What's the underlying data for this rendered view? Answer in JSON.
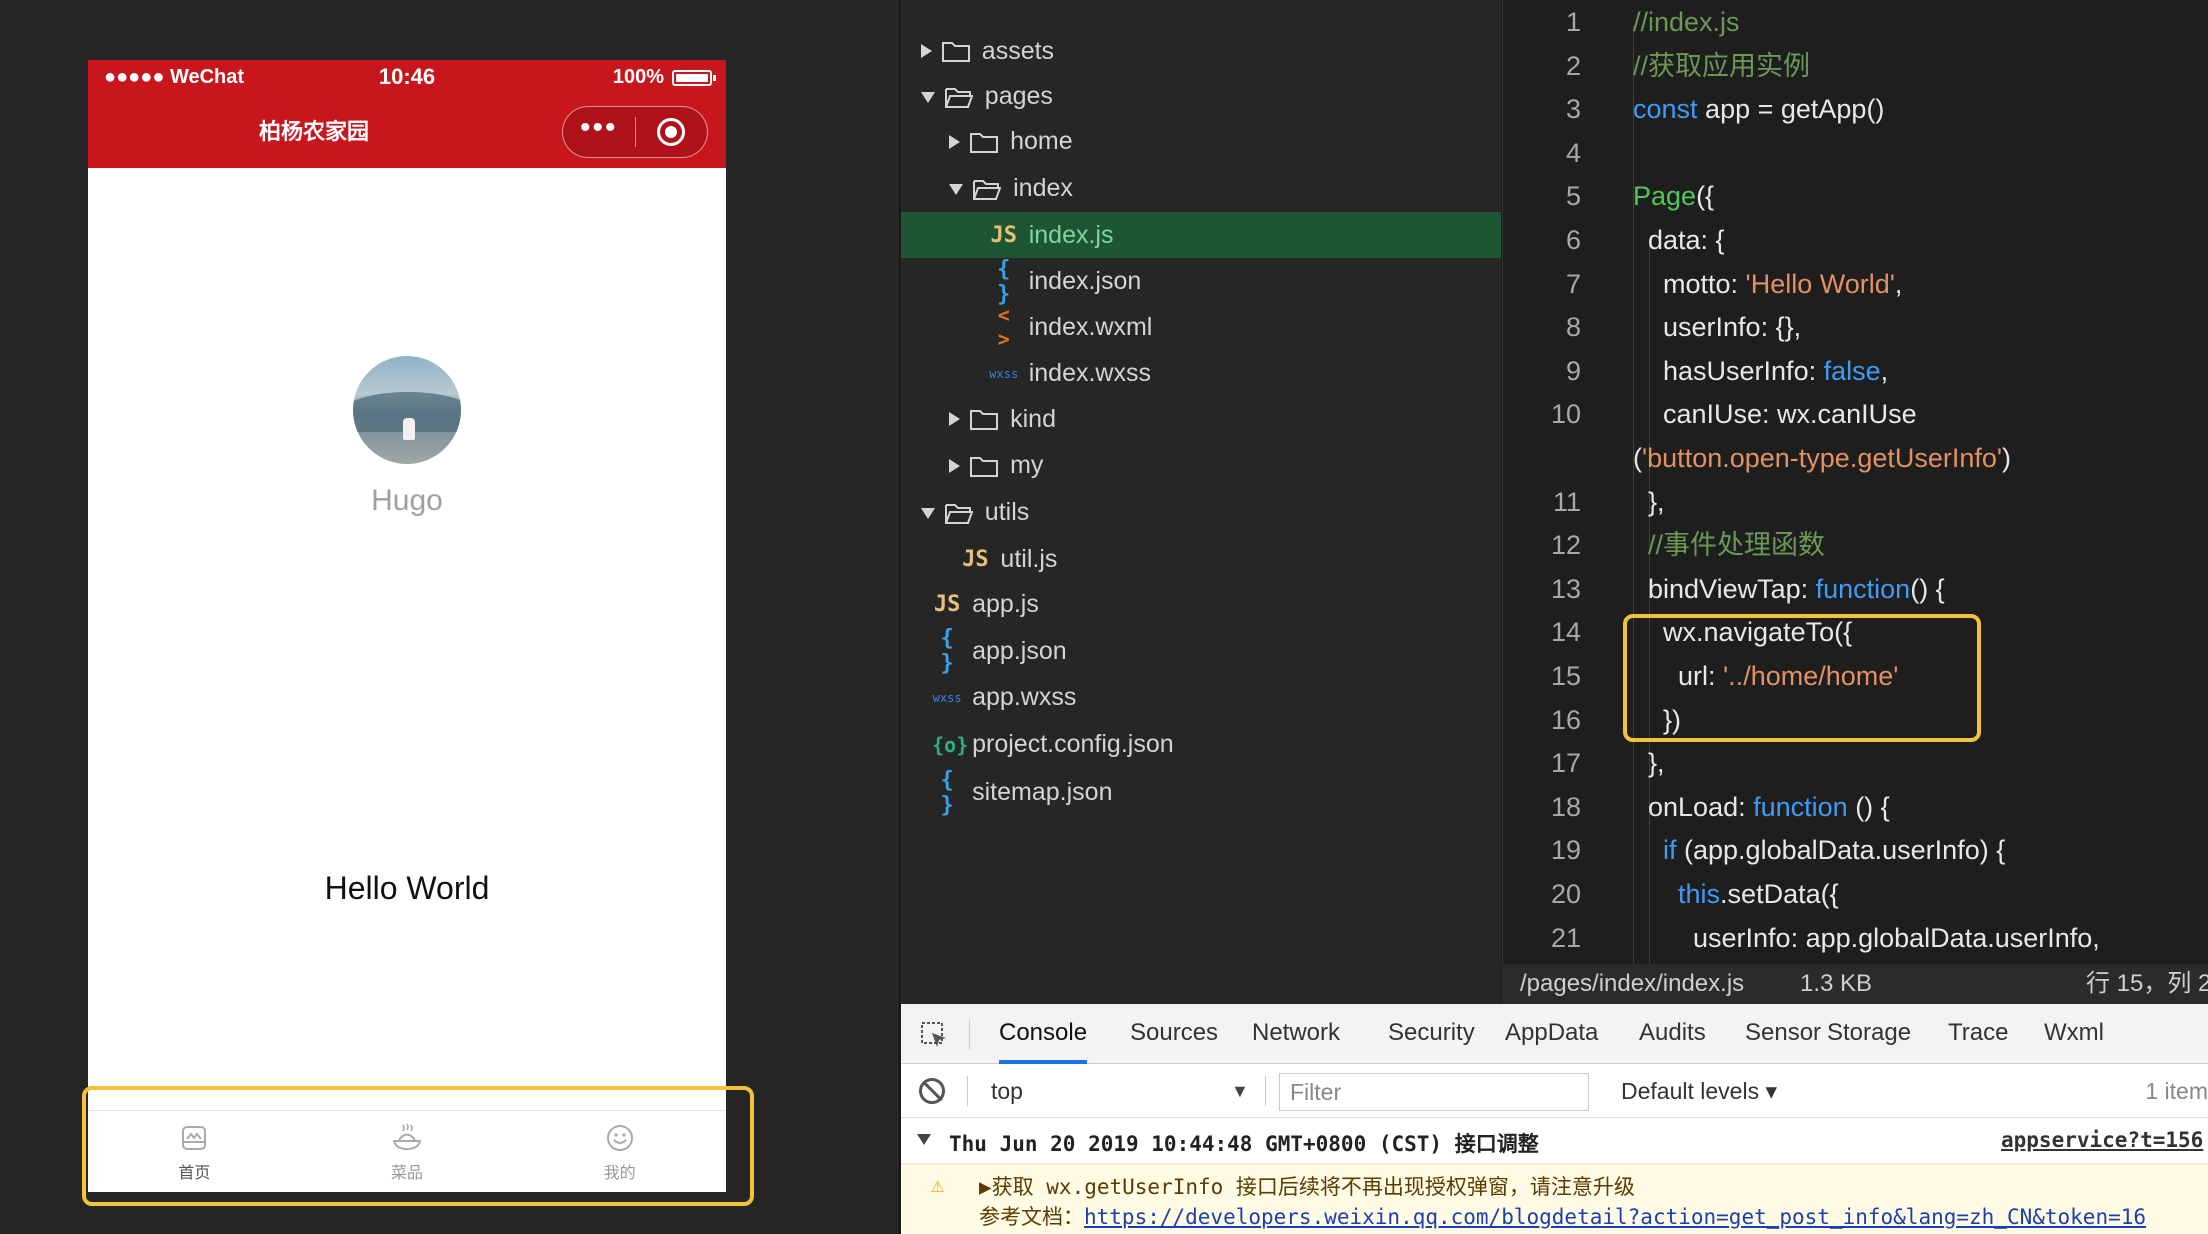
{
  "simulator": {
    "status_left": "●●●●● WeChat",
    "time": "10:46",
    "battery": "100%",
    "nav_title": "柏杨农家园",
    "capsule_more": "•••",
    "nickname": "Hugo",
    "motto": "Hello World",
    "tabs": [
      {
        "label": "首页",
        "icon": "home-icon"
      },
      {
        "label": "菜品",
        "icon": "dish-icon"
      },
      {
        "label": "我的",
        "icon": "smiley-icon"
      }
    ]
  },
  "file_tree": [
    {
      "label": "assets",
      "type": "folder",
      "state": "collapsed"
    },
    {
      "label": "pages",
      "type": "folder",
      "state": "expanded"
    },
    {
      "label": "home",
      "type": "folder",
      "state": "collapsed"
    },
    {
      "label": "index",
      "type": "folder",
      "state": "expanded"
    },
    {
      "label": "index.js",
      "type": "js",
      "icon_text": "JS"
    },
    {
      "label": "index.json",
      "type": "json",
      "icon_text": "{ }"
    },
    {
      "label": "index.wxml",
      "type": "wxml",
      "icon_text": "< >"
    },
    {
      "label": "index.wxss",
      "type": "wxss",
      "icon_text": "wxss"
    },
    {
      "label": "kind",
      "type": "folder",
      "state": "collapsed"
    },
    {
      "label": "my",
      "type": "folder",
      "state": "collapsed"
    },
    {
      "label": "utils",
      "type": "folder",
      "state": "expanded"
    },
    {
      "label": "util.js",
      "type": "js",
      "icon_text": "JS"
    },
    {
      "label": "app.js",
      "type": "js",
      "icon_text": "JS"
    },
    {
      "label": "app.json",
      "type": "json",
      "icon_text": "{ }"
    },
    {
      "label": "app.wxss",
      "type": "wxss",
      "icon_text": "wxss"
    },
    {
      "label": "project.config.json",
      "type": "cfg",
      "icon_text": "{o}"
    },
    {
      "label": "sitemap.json",
      "type": "json",
      "icon_text": "{ }"
    }
  ],
  "editor": {
    "lines": [
      {
        "n": "1",
        "parts": [
          [
            "c",
            "//index.js"
          ]
        ]
      },
      {
        "n": "2",
        "parts": [
          [
            "c",
            "//获取应用实例"
          ]
        ]
      },
      {
        "n": "3",
        "parts": [
          [
            "k",
            "const"
          ],
          [
            "t",
            " app = getApp()"
          ]
        ]
      },
      {
        "n": "4",
        "parts": []
      },
      {
        "n": "5",
        "parts": [
          [
            "f",
            "Page"
          ],
          [
            "t",
            "({"
          ]
        ]
      },
      {
        "n": "6",
        "parts": [
          [
            "t",
            "  data: {"
          ]
        ]
      },
      {
        "n": "7",
        "parts": [
          [
            "t",
            "    motto: "
          ],
          [
            "s",
            "'Hello World'"
          ],
          [
            "t",
            ","
          ]
        ]
      },
      {
        "n": "8",
        "parts": [
          [
            "t",
            "    userInfo: {},"
          ]
        ]
      },
      {
        "n": "9",
        "parts": [
          [
            "t",
            "    hasUserInfo: "
          ],
          [
            "k",
            "false"
          ],
          [
            "t",
            ","
          ]
        ]
      },
      {
        "n": "10",
        "parts": [
          [
            "t",
            "    canIUse: wx.canIUse"
          ]
        ]
      },
      {
        "n": "",
        "parts": [
          [
            "t",
            "("
          ],
          [
            "s",
            "'button.open-type.getUserInfo'"
          ],
          [
            "t",
            ")"
          ]
        ]
      },
      {
        "n": "11",
        "parts": [
          [
            "t",
            "  },"
          ]
        ]
      },
      {
        "n": "12",
        "parts": [
          [
            "c",
            "  //事件处理函数"
          ]
        ]
      },
      {
        "n": "13",
        "parts": [
          [
            "t",
            "  bindViewTap: "
          ],
          [
            "k",
            "function"
          ],
          [
            "t",
            "() {"
          ]
        ]
      },
      {
        "n": "14",
        "parts": [
          [
            "t",
            "    wx.navigateTo({"
          ]
        ]
      },
      {
        "n": "15",
        "parts": [
          [
            "t",
            "      url: "
          ],
          [
            "s",
            "'../home/home'"
          ]
        ]
      },
      {
        "n": "16",
        "parts": [
          [
            "t",
            "    })"
          ]
        ]
      },
      {
        "n": "17",
        "parts": [
          [
            "t",
            "  },"
          ]
        ]
      },
      {
        "n": "18",
        "parts": [
          [
            "t",
            "  onLoad: "
          ],
          [
            "k",
            "function"
          ],
          [
            "t",
            " () {"
          ]
        ]
      },
      {
        "n": "19",
        "parts": [
          [
            "t",
            "    "
          ],
          [
            "k",
            "if"
          ],
          [
            "t",
            " (app.globalData.userInfo) {"
          ]
        ]
      },
      {
        "n": "20",
        "parts": [
          [
            "t",
            "      "
          ],
          [
            "k",
            "this"
          ],
          [
            "t",
            ".setData({"
          ]
        ]
      },
      {
        "n": "21",
        "parts": [
          [
            "t",
            "        userInfo: app.globalData.userInfo,"
          ]
        ]
      }
    ],
    "status_path": "/pages/index/index.js",
    "status_size": "1.3 KB",
    "status_pos": "行 15，列 2"
  },
  "devtools": {
    "tabs": [
      "Console",
      "Sources",
      "Network",
      "Security",
      "AppData",
      "Audits",
      "Sensor",
      "Storage",
      "Trace",
      "Wxml"
    ],
    "active_tab": "Console",
    "context": "top",
    "filter_placeholder": "Filter",
    "levels": "Default levels ▾",
    "item_count": "1 item",
    "log_text": "Thu Jun 20 2019 10:44:48 GMT+0800 (CST) 接口调整",
    "log_source": "appservice?t=156",
    "warn_line1": "▶获取 wx.getUserInfo 接口后续将不再出现授权弹窗，请注意升级",
    "warn_line2_prefix": "参考文档：",
    "warn_link": "https://developers.weixin.qq.com/blogdetail?action=get_post_info&lang=zh_CN&token=16"
  },
  "colors": {
    "wechat_red": "#c8161d",
    "highlight": "#f4c23a",
    "selected_file": "#1e5533"
  }
}
